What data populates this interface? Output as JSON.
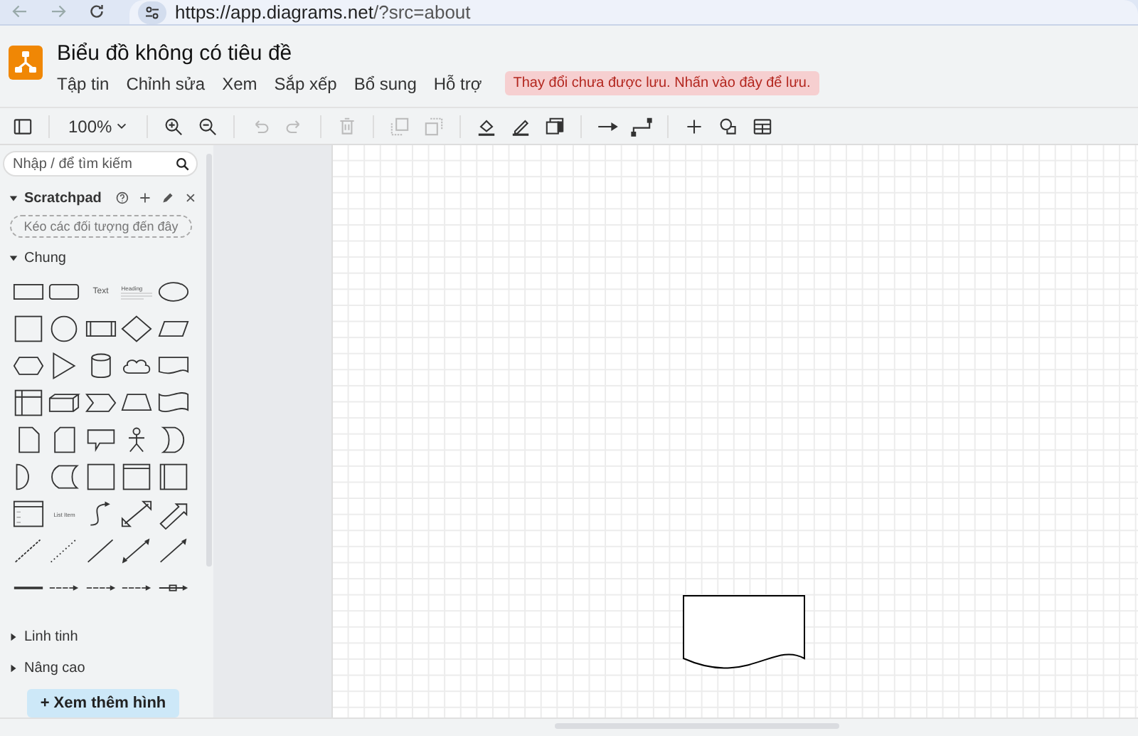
{
  "browser": {
    "url_host": "https://app.diagrams.net",
    "url_path": "/?src=about"
  },
  "app": {
    "title": "Biểu đồ không có tiêu đề",
    "menu": [
      "Tập tin",
      "Chỉnh sửa",
      "Xem",
      "Sắp xếp",
      "Bổ sung",
      "Hỗ trợ"
    ],
    "save_notice": "Thay đổi chưa được lưu. Nhấn vào đây để lưu."
  },
  "toolbar": [
    {
      "kind": "format-panel",
      "disabled": false
    },
    {
      "kind": "zoom",
      "label": "100%",
      "disabled": false
    },
    {
      "kind": "zoom-in",
      "disabled": false
    },
    {
      "kind": "zoom-out",
      "disabled": false
    },
    {
      "kind": "undo",
      "disabled": true
    },
    {
      "kind": "redo",
      "disabled": true
    },
    {
      "kind": "delete",
      "disabled": true
    },
    {
      "kind": "to-front",
      "disabled": true
    },
    {
      "kind": "to-back",
      "disabled": true
    },
    {
      "kind": "fill",
      "disabled": false
    },
    {
      "kind": "line-color",
      "disabled": false
    },
    {
      "kind": "shadow",
      "disabled": false
    },
    {
      "kind": "connection",
      "disabled": false
    },
    {
      "kind": "waypoints",
      "disabled": false
    },
    {
      "kind": "insert",
      "disabled": false
    },
    {
      "kind": "shapes",
      "disabled": false
    },
    {
      "kind": "table",
      "disabled": false
    }
  ],
  "sidebar": {
    "search": {
      "placeholder": "Nhập / để tìm kiếm"
    },
    "scratchpad": {
      "title": "Scratchpad",
      "expanded": true,
      "drop_hint": "Kéo các đối tượng đến đây"
    },
    "sections": [
      {
        "title": "Chung",
        "expanded": true,
        "shapes": [
          {
            "kind": "rect"
          },
          {
            "kind": "rounded"
          },
          {
            "kind": "text",
            "label": "Text"
          },
          {
            "kind": "heading",
            "label": "Heading"
          },
          {
            "kind": "ellipse"
          },
          {
            "kind": "square"
          },
          {
            "kind": "circle"
          },
          {
            "kind": "process"
          },
          {
            "kind": "diamond"
          },
          {
            "kind": "parallelogram"
          },
          {
            "kind": "hexagon"
          },
          {
            "kind": "triangle"
          },
          {
            "kind": "cylinder"
          },
          {
            "kind": "cloud"
          },
          {
            "kind": "document"
          },
          {
            "kind": "internal-storage"
          },
          {
            "kind": "cube"
          },
          {
            "kind": "step"
          },
          {
            "kind": "trapezoid"
          },
          {
            "kind": "tape"
          },
          {
            "kind": "note"
          },
          {
            "kind": "card"
          },
          {
            "kind": "callout"
          },
          {
            "kind": "actor"
          },
          {
            "kind": "or"
          },
          {
            "kind": "delay"
          },
          {
            "kind": "data-storage"
          },
          {
            "kind": "square"
          },
          {
            "kind": "container"
          },
          {
            "kind": "swimlane"
          },
          {
            "kind": "list"
          },
          {
            "kind": "list-item",
            "label": "List Item"
          },
          {
            "kind": "curve"
          },
          {
            "kind": "bidir-arrow"
          },
          {
            "kind": "arrow"
          },
          {
            "kind": "dashed-line"
          },
          {
            "kind": "dotted-line"
          },
          {
            "kind": "line"
          },
          {
            "kind": "bidir-line"
          },
          {
            "kind": "directed-line"
          },
          {
            "kind": "thick-line"
          },
          {
            "kind": "connector"
          },
          {
            "kind": "connector"
          },
          {
            "kind": "connector"
          },
          {
            "kind": "box-connector"
          }
        ]
      },
      {
        "title": "Linh tinh",
        "expanded": false
      },
      {
        "title": "Nâng cao",
        "expanded": false
      }
    ],
    "more_shapes": "+ Xem thêm hình"
  },
  "canvas": {
    "shapes": [
      {
        "kind": "document"
      }
    ]
  }
}
